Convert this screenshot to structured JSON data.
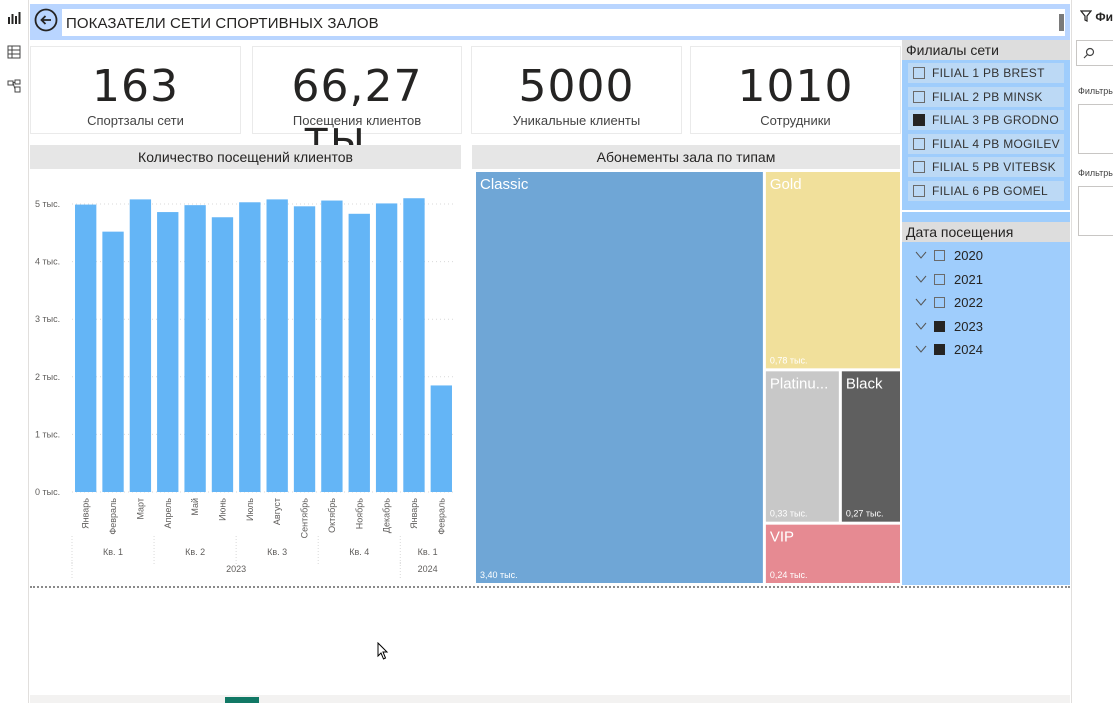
{
  "report": {
    "title": "ПОКАЗАТЕЛИ СЕТИ СПОРТИВНЫХ ЗАЛОВ"
  },
  "kpis": [
    {
      "value": "163",
      "label": "Спортзалы сети"
    },
    {
      "value": "66,27 ты...",
      "label": "Посещения клиентов"
    },
    {
      "value": "5000",
      "label": "Уникальные клиенты"
    },
    {
      "value": "1010",
      "label": "Сотрудники"
    }
  ],
  "bar_panel": {
    "title": "Количество посещений клиентов"
  },
  "tree_panel": {
    "title": "Абонементы зала по типам"
  },
  "branches": {
    "title": "Филиалы сети",
    "items": [
      {
        "label": "FILIAL 1 PB BREST",
        "checked": false
      },
      {
        "label": "FILIAL 2 PB MINSK",
        "checked": false
      },
      {
        "label": "FILIAL 3 PB GRODNO",
        "checked": true
      },
      {
        "label": "FILIAL 4 PB MOGILEV",
        "checked": false
      },
      {
        "label": "FILIAL 5 PB VITEBSK",
        "checked": false
      },
      {
        "label": "FILIAL 6 PB GOMEL",
        "checked": false
      }
    ]
  },
  "visit_date": {
    "title": "Дата посещения",
    "years": [
      {
        "label": "2020",
        "checked": false
      },
      {
        "label": "2021",
        "checked": false
      },
      {
        "label": "2022",
        "checked": false
      },
      {
        "label": "2023",
        "checked": true
      },
      {
        "label": "2024",
        "checked": true
      }
    ]
  },
  "filters_pane": {
    "title": "Фи",
    "label1": "Фильтры",
    "label2": "Фильтры"
  },
  "colors": {
    "bar": "#64b5f6",
    "classic": "#6fa6d6",
    "gold": "#f1e09b",
    "platinum": "#c8c8c8",
    "black": "#5f5f5f",
    "vip": "#e68a92",
    "slicer_bg": "#9fcdfc",
    "title_bar": "#b9d5ff"
  },
  "chart_data": [
    {
      "type": "bar",
      "title": "Количество посещений клиентов",
      "categories": [
        "Январь",
        "Февраль",
        "Март",
        "Апрель",
        "Май",
        "Июнь",
        "Июль",
        "Август",
        "Сентябрь",
        "Октябрь",
        "Ноябрь",
        "Декабрь",
        "Январь",
        "Февраль"
      ],
      "quarters": [
        {
          "label": "Кв. 1",
          "span": 3
        },
        {
          "label": "Кв. 2",
          "span": 3
        },
        {
          "label": "Кв. 3",
          "span": 3
        },
        {
          "label": "Кв. 4",
          "span": 3
        },
        {
          "label": "Кв. 1",
          "span": 2
        }
      ],
      "years": [
        {
          "label": "2023",
          "span": 12
        },
        {
          "label": "2024",
          "span": 2
        }
      ],
      "values": [
        4990,
        4520,
        5080,
        4860,
        4980,
        4770,
        5030,
        5080,
        4960,
        5060,
        4830,
        5010,
        5100,
        1850
      ],
      "yticks": [
        "0 тыс.",
        "1 тыс.",
        "2 тыс.",
        "3 тыс.",
        "4 тыс.",
        "5 тыс."
      ],
      "ylim": [
        0,
        5000
      ],
      "grid": true
    },
    {
      "type": "treemap",
      "title": "Абонементы зала по типам",
      "items": [
        {
          "name": "Classic",
          "value": 3.4,
          "label": "3,40 тыс."
        },
        {
          "name": "Gold",
          "value": 0.78,
          "label": "0,78 тыс."
        },
        {
          "name": "Platinu...",
          "value": 0.33,
          "label": "0,33 тыс."
        },
        {
          "name": "Black",
          "value": 0.27,
          "label": "0,27 тыс."
        },
        {
          "name": "VIP",
          "value": 0.24,
          "label": "0,24 тыс."
        }
      ]
    }
  ]
}
